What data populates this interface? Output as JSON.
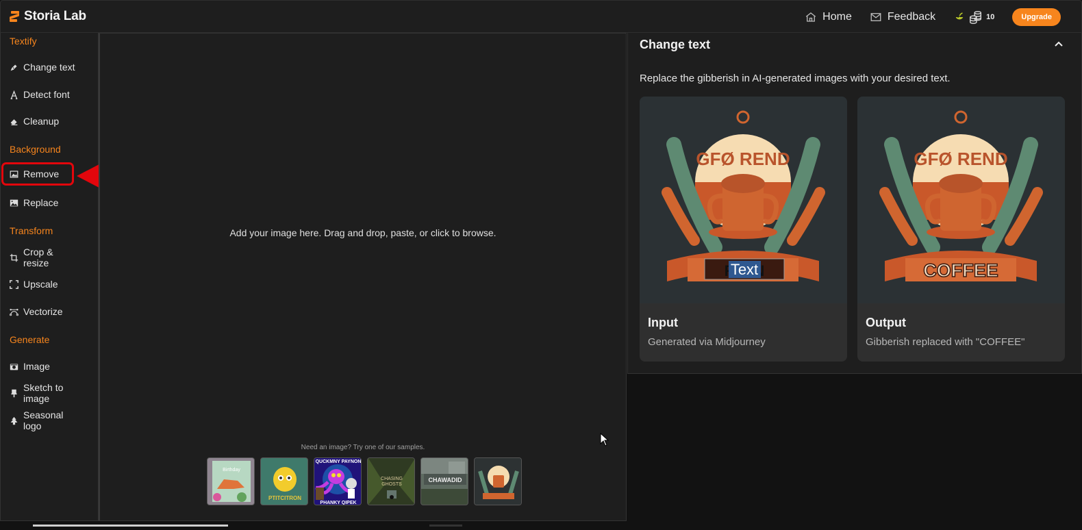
{
  "app": {
    "name": "Storia Lab",
    "brand_color": "#f7851d"
  },
  "header": {
    "nav": [
      {
        "label": "Home",
        "icon": "home-icon"
      },
      {
        "label": "Feedback",
        "icon": "mail-icon"
      }
    ],
    "credits": {
      "count": "10",
      "icon": "coins-icon"
    },
    "upgrade_label": "Upgrade"
  },
  "sidebar": {
    "sections": [
      {
        "label": "Textify",
        "items": [
          {
            "label": "Change text",
            "icon": "pen-nib-icon"
          },
          {
            "label": "Detect font",
            "icon": "font-icon"
          },
          {
            "label": "Cleanup",
            "icon": "eraser-icon"
          }
        ]
      },
      {
        "label": "Background",
        "items": [
          {
            "label": "Remove",
            "icon": "image-outline-icon",
            "highlighted": true
          },
          {
            "label": "Replace",
            "icon": "image-icon"
          }
        ]
      },
      {
        "label": "Transform",
        "items": [
          {
            "label": "Crop & resize",
            "icon": "crop-icon"
          },
          {
            "label": "Upscale",
            "icon": "expand-icon"
          },
          {
            "label": "Vectorize",
            "icon": "bezier-icon"
          }
        ]
      },
      {
        "label": "Generate",
        "items": [
          {
            "label": "Image",
            "icon": "camera-icon"
          },
          {
            "label": "Sketch to image",
            "icon": "brush-icon"
          },
          {
            "label": "Seasonal logo",
            "icon": "tree-icon"
          }
        ]
      }
    ]
  },
  "dropzone": {
    "prompt": "Add your image here. Drag and drop, paste, or click to browse.",
    "samples_label": "Need an image? Try one of our samples.",
    "samples": [
      {
        "caption": "Birthday",
        "bg": "#8f8590"
      },
      {
        "caption": "PTITCITRON",
        "bg": "#3f7a6b"
      },
      {
        "caption": "QUCKMNY PAYNON / PHANKY QIPEK",
        "bg": "#2c1a8a"
      },
      {
        "caption": "CHASING GHOSTS",
        "bg": "#3a4a2a"
      },
      {
        "caption": "CHAWADID",
        "bg": "#5c6a5e"
      },
      {
        "caption": "",
        "bg": "#2d3233"
      }
    ]
  },
  "panel": {
    "title": "Change text",
    "description": "Replace the gibberish in AI-generated images with your desired text.",
    "cards": [
      {
        "title": "Input",
        "subtitle": "Generated via Midjourney",
        "image_top_text": "GFØ REND",
        "banner_text": "RI  EN",
        "edit_text": "Text"
      },
      {
        "title": "Output",
        "subtitle": "Gibberish replaced with \"COFFEE\"",
        "image_top_text": "GFØ REND",
        "banner_text": "COFFEE"
      }
    ]
  }
}
